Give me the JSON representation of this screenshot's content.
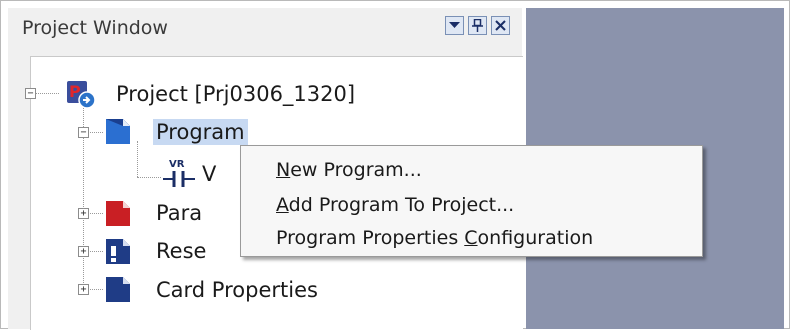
{
  "panel": {
    "title": "Project Window",
    "buttons": {
      "dropdown_icon": "dropdown-arrow-icon",
      "pin_icon": "pin-icon",
      "close_icon": "close-icon"
    }
  },
  "tree": {
    "root": {
      "label": "Project [Prj0306_1320]",
      "expander": "⊟",
      "icon": "project-icon"
    },
    "program": {
      "label": "Program",
      "expander": "⊟",
      "icon": "program-folder-icon"
    },
    "program_child": {
      "label": "V",
      "icon": "ladder-contact-icon",
      "icon_text": "VR"
    },
    "parameter": {
      "label": "Para",
      "expander": "+",
      "icon": "parameter-icon"
    },
    "reserved": {
      "label": "Rese",
      "expander": "+",
      "icon": "reserved-icon"
    },
    "card": {
      "label": "Card Properties",
      "expander": "+",
      "icon": "card-icon"
    }
  },
  "context_menu": {
    "items": [
      {
        "pre": "",
        "mnemonic": "N",
        "post": "ew Program..."
      },
      {
        "pre": "",
        "mnemonic": "A",
        "post": "dd Program To Project..."
      },
      {
        "pre": "Program Properties ",
        "mnemonic": "C",
        "post": "onfiguration"
      }
    ]
  },
  "colors": {
    "selection": "#c7d9f2",
    "right_pane": "#8b93ac",
    "panel_bg": "#f0f0f0"
  }
}
